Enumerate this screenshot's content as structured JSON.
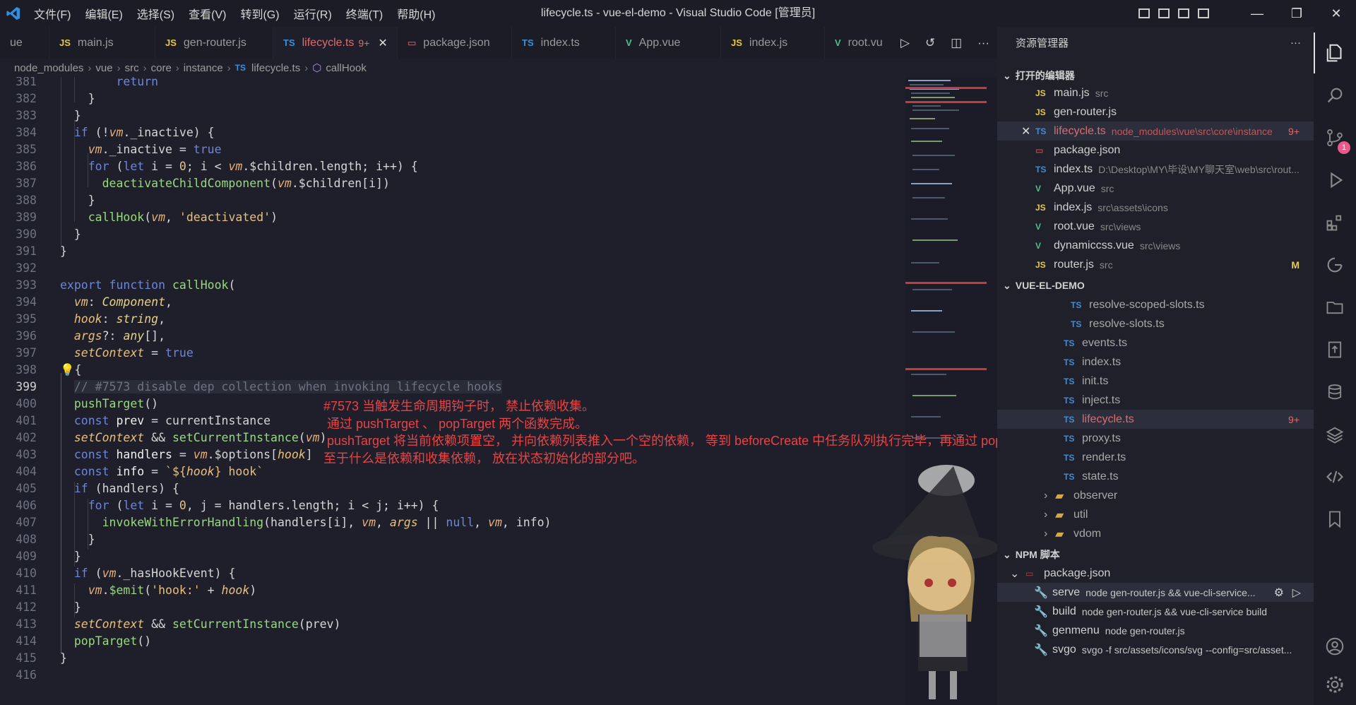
{
  "window": {
    "title": "lifecycle.ts - vue-el-demo - Visual Studio Code [管理员]"
  },
  "menu": [
    "文件(F)",
    "编辑(E)",
    "选择(S)",
    "查看(V)",
    "转到(G)",
    "运行(R)",
    "终端(T)",
    "帮助(H)"
  ],
  "tabs": [
    {
      "label": "ue",
      "icon": "",
      "icon_color": "#9a9a9a"
    },
    {
      "label": "main.js",
      "icon": "JS",
      "icon_color": "#e8c94a"
    },
    {
      "label": "gen-router.js",
      "icon": "JS",
      "icon_color": "#e8c94a"
    },
    {
      "label": "lifecycle.ts",
      "icon": "TS",
      "icon_color": "#3f8ed8",
      "badge": "9+",
      "close": "✕"
    },
    {
      "label": "package.json",
      "icon": "▭",
      "icon_color": "#c93e3e"
    },
    {
      "label": "index.ts",
      "icon": "TS",
      "icon_color": "#3f8ed8"
    },
    {
      "label": "App.vue",
      "icon": "V",
      "icon_color": "#4fc08d"
    },
    {
      "label": "index.js",
      "icon": "JS",
      "icon_color": "#e8c94a"
    },
    {
      "label": "root.vu",
      "icon": "V",
      "icon_color": "#4fc08d"
    }
  ],
  "breadcrumb": {
    "parts": [
      "node_modules",
      "vue",
      "src",
      "core",
      "instance"
    ],
    "file_icon": "TS",
    "file": "lifecycle.ts",
    "symbol": "callHook"
  },
  "editor": {
    "line_numbers": [
      "381",
      "382",
      "383",
      "384",
      "385",
      "386",
      "387",
      "388",
      "389",
      "390",
      "391",
      "392",
      "393",
      "394",
      "395",
      "396",
      "397",
      "398",
      "399",
      "400",
      "401",
      "402",
      "403",
      "404",
      "405",
      "406",
      "407",
      "408",
      "409",
      "410",
      "411",
      "412",
      "413",
      "414",
      "415",
      "416"
    ],
    "current_line": "399",
    "annotation": [
      "#7573 当触发生命周期钩子时， 禁止依赖收集。",
      " 通过 pushTarget 、 popTarget 两个函数完成。",
      " pushTarget 将当前依赖项置空， 并向依赖列表推入一个空的依赖， 等到 beforeCreate 中任务队列执行完毕，再通过 popTarget 将刚才加入的空依赖删除。",
      "至于什么是依赖和收集依赖， 放在状态初始化的部分吧。"
    ]
  },
  "explorer": {
    "title": "资源管理器",
    "more": "···",
    "open_editors_header": "打开的编辑器",
    "open_editors": [
      {
        "icon": "JS",
        "icon_color": "#e8c94a",
        "name": "main.js",
        "sub": "src"
      },
      {
        "icon": "JS",
        "icon_color": "#e8c94a",
        "name": "gen-router.js",
        "sub": ""
      },
      {
        "icon": "TS",
        "icon_color": "#3f8ed8",
        "name": "lifecycle.ts",
        "sub": "node_modules\\vue\\src\\core\\instance",
        "badge": "9+",
        "selected": true
      },
      {
        "icon": "▭",
        "icon_color": "#c93e3e",
        "name": "package.json",
        "sub": ""
      },
      {
        "icon": "TS",
        "icon_color": "#3f8ed8",
        "name": "index.ts",
        "sub": "D:\\Desktop\\MY\\毕设\\MY聊天室\\web\\src\\rout..."
      },
      {
        "icon": "V",
        "icon_color": "#4fc08d",
        "name": "App.vue",
        "sub": "src"
      },
      {
        "icon": "JS",
        "icon_color": "#e8c94a",
        "name": "index.js",
        "sub": "src\\assets\\icons"
      },
      {
        "icon": "V",
        "icon_color": "#4fc08d",
        "name": "root.vue",
        "sub": "src\\views"
      },
      {
        "icon": "V",
        "icon_color": "#4fc08d",
        "name": "dynamiccss.vue",
        "sub": "src\\views"
      },
      {
        "icon": "JS",
        "icon_color": "#e8c94a",
        "name": "router.js",
        "sub": "src",
        "badge": "M"
      }
    ],
    "project_header": "VUE-EL-DEMO",
    "project_files": [
      {
        "icon": "TS",
        "name": "resolve-scoped-slots.ts",
        "depth": 2
      },
      {
        "icon": "TS",
        "name": "resolve-slots.ts",
        "depth": 2
      },
      {
        "icon": "TS",
        "name": "events.ts",
        "depth": 1
      },
      {
        "icon": "TS",
        "name": "index.ts",
        "depth": 1
      },
      {
        "icon": "TS",
        "name": "init.ts",
        "depth": 1
      },
      {
        "icon": "TS",
        "name": "inject.ts",
        "depth": 1
      },
      {
        "icon": "TS",
        "name": "lifecycle.ts",
        "depth": 1,
        "badge": "9+",
        "selected": true
      },
      {
        "icon": "TS",
        "name": "proxy.ts",
        "depth": 1
      },
      {
        "icon": "TS",
        "name": "render.ts",
        "depth": 1
      },
      {
        "icon": "TS",
        "name": "state.ts",
        "depth": 1
      },
      {
        "icon": "folder",
        "name": "observer",
        "depth": 0
      },
      {
        "icon": "folder",
        "name": "util",
        "depth": 0
      },
      {
        "icon": "folder",
        "name": "vdom",
        "depth": 0
      }
    ],
    "npm_header": "NPM 脚本",
    "npm_package": "package.json",
    "npm_scripts": [
      {
        "name": "serve",
        "cmd": "node gen-router.js && vue-cli-service..."
      },
      {
        "name": "build",
        "cmd": "node gen-router.js && vue-cli-service build"
      },
      {
        "name": "genmenu",
        "cmd": "node gen-router.js"
      },
      {
        "name": "svgo",
        "cmd": "svgo -f src/assets/icons/svg --config=src/asset..."
      }
    ]
  },
  "activity": {
    "scm_badge": "1"
  },
  "colors": {
    "accent_error": "#e64545",
    "ts_icon": "#3f8ed8",
    "js_icon": "#e8c94a",
    "vue_icon": "#4fc08d"
  }
}
